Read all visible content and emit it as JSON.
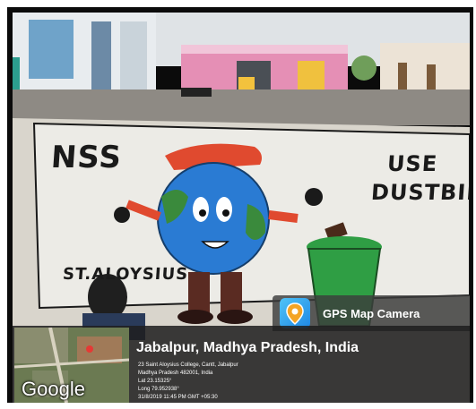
{
  "wall_mural": {
    "top_left": "NSS",
    "top_right_line1": "USE",
    "top_right_line2": "DUSTBIN",
    "bottom_left": "ST.ALOYSIUS"
  },
  "overlay": {
    "app_name": "GPS Map Camera",
    "map_brand": "Google",
    "location_title": "Jabalpur, Madhya Pradesh, India",
    "address_line1": "23 Saint Aloysius College, Cantt, Jabalpur",
    "address_line2": "Madhya Pradesh 482001, India",
    "latitude": "Lat 23.15325°",
    "longitude": "Long 79.952938°",
    "timestamp": "31/8/2019 11:45 PM GMT +05:30"
  },
  "colors": {
    "globe_blue": "#2a7bd3",
    "land_green": "#3a8a3c",
    "cap_red": "#e04a2f",
    "bin_green": "#2f9e44"
  }
}
